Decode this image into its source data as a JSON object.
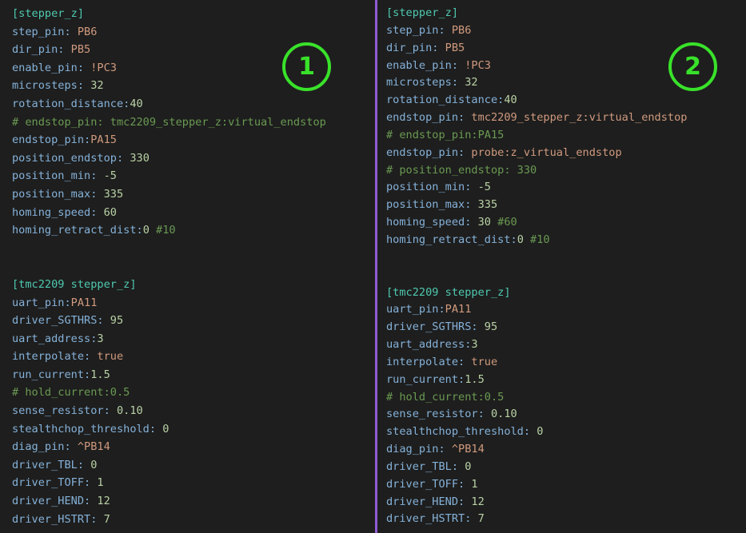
{
  "panels": [
    {
      "badge": "1",
      "lines": [
        {
          "type": "section",
          "text": "[stepper_z]"
        },
        {
          "type": "kv",
          "key": "step_pin: ",
          "value": "PB6",
          "vtype": "str"
        },
        {
          "type": "kv",
          "key": "dir_pin: ",
          "value": "PB5",
          "vtype": "str"
        },
        {
          "type": "kv",
          "key": "enable_pin: ",
          "value": "!PC3",
          "vtype": "str"
        },
        {
          "type": "kv",
          "key": "microsteps: ",
          "value": "32",
          "vtype": "num"
        },
        {
          "type": "kv",
          "key": "rotation_distance:",
          "value": "40",
          "vtype": "num"
        },
        {
          "type": "comment",
          "text": "# endstop_pin: tmc2209_stepper_z:virtual_endstop"
        },
        {
          "type": "kv",
          "key": "endstop_pin:",
          "value": "PA15",
          "vtype": "str"
        },
        {
          "type": "kv",
          "key": "position_endstop: ",
          "value": "330",
          "vtype": "num"
        },
        {
          "type": "kv",
          "key": "position_min: ",
          "value": "-5",
          "vtype": "num"
        },
        {
          "type": "kv",
          "key": "position_max: ",
          "value": "335",
          "vtype": "num"
        },
        {
          "type": "kv",
          "key": "homing_speed: ",
          "value": "60",
          "vtype": "num"
        },
        {
          "type": "kv",
          "key": "homing_retract_dist:",
          "value": "0",
          "vtype": "num",
          "comment": " #10"
        },
        {
          "type": "blank"
        },
        {
          "type": "blank"
        },
        {
          "type": "section",
          "text": "[tmc2209 stepper_z]"
        },
        {
          "type": "kv",
          "key": "uart_pin:",
          "value": "PA11",
          "vtype": "str"
        },
        {
          "type": "kv",
          "key": "driver_SGTHRS: ",
          "value": "95",
          "vtype": "num"
        },
        {
          "type": "kv",
          "key": "uart_address:",
          "value": "3",
          "vtype": "num"
        },
        {
          "type": "kv",
          "key": "interpolate: ",
          "value": "true",
          "vtype": "str"
        },
        {
          "type": "kv",
          "key": "run_current:",
          "value": "1.5",
          "vtype": "num"
        },
        {
          "type": "comment",
          "text": "# hold_current:0.5"
        },
        {
          "type": "kv",
          "key": "sense_resistor: ",
          "value": "0.10",
          "vtype": "num"
        },
        {
          "type": "kv",
          "key": "stealthchop_threshold: ",
          "value": "0",
          "vtype": "num"
        },
        {
          "type": "kv",
          "key": "diag_pin: ",
          "value": "^PB14",
          "vtype": "str"
        },
        {
          "type": "kv",
          "key": "driver_TBL: ",
          "value": "0",
          "vtype": "num"
        },
        {
          "type": "kv",
          "key": "driver_TOFF: ",
          "value": "1",
          "vtype": "num"
        },
        {
          "type": "kv",
          "key": "driver_HEND: ",
          "value": "12",
          "vtype": "num"
        },
        {
          "type": "kv",
          "key": "driver_HSTRT: ",
          "value": "7",
          "vtype": "num"
        }
      ]
    },
    {
      "badge": "2",
      "lines": [
        {
          "type": "section",
          "text": "[stepper_z]"
        },
        {
          "type": "kv",
          "key": "step_pin: ",
          "value": "PB6",
          "vtype": "str"
        },
        {
          "type": "kv",
          "key": "dir_pin: ",
          "value": "PB5",
          "vtype": "str"
        },
        {
          "type": "kv",
          "key": "enable_pin: ",
          "value": "!PC3",
          "vtype": "str"
        },
        {
          "type": "kv",
          "key": "microsteps: ",
          "value": "32",
          "vtype": "num"
        },
        {
          "type": "kv",
          "key": "rotation_distance:",
          "value": "40",
          "vtype": "num"
        },
        {
          "type": "kv",
          "key": "endstop_pin: ",
          "value": "tmc2209_stepper_z:virtual_endstop",
          "vtype": "str"
        },
        {
          "type": "comment",
          "text": "# endstop_pin:PA15"
        },
        {
          "type": "kv",
          "key": "endstop_pin: ",
          "value": "probe:z_virtual_endstop",
          "vtype": "str"
        },
        {
          "type": "comment",
          "text": "# position_endstop: 330"
        },
        {
          "type": "kv",
          "key": "position_min: ",
          "value": "-5",
          "vtype": "num"
        },
        {
          "type": "kv",
          "key": "position_max: ",
          "value": "335",
          "vtype": "num"
        },
        {
          "type": "kv",
          "key": "homing_speed: ",
          "value": "30",
          "vtype": "num",
          "comment": " #60"
        },
        {
          "type": "kv",
          "key": "homing_retract_dist:",
          "value": "0",
          "vtype": "num",
          "comment": " #10"
        },
        {
          "type": "blank"
        },
        {
          "type": "blank"
        },
        {
          "type": "section",
          "text": "[tmc2209 stepper_z]"
        },
        {
          "type": "kv",
          "key": "uart_pin:",
          "value": "PA11",
          "vtype": "str"
        },
        {
          "type": "kv",
          "key": "driver_SGTHRS: ",
          "value": "95",
          "vtype": "num"
        },
        {
          "type": "kv",
          "key": "uart_address:",
          "value": "3",
          "vtype": "num"
        },
        {
          "type": "kv",
          "key": "interpolate: ",
          "value": "true",
          "vtype": "str"
        },
        {
          "type": "kv",
          "key": "run_current:",
          "value": "1.5",
          "vtype": "num"
        },
        {
          "type": "comment",
          "text": "# hold_current:0.5"
        },
        {
          "type": "kv",
          "key": "sense_resistor: ",
          "value": "0.10",
          "vtype": "num"
        },
        {
          "type": "kv",
          "key": "stealthchop_threshold: ",
          "value": "0",
          "vtype": "num"
        },
        {
          "type": "kv",
          "key": "diag_pin: ",
          "value": "^PB14",
          "vtype": "str"
        },
        {
          "type": "kv",
          "key": "driver_TBL: ",
          "value": "0",
          "vtype": "num"
        },
        {
          "type": "kv",
          "key": "driver_TOFF: ",
          "value": "1",
          "vtype": "num"
        },
        {
          "type": "kv",
          "key": "driver_HEND: ",
          "value": "12",
          "vtype": "num"
        },
        {
          "type": "kv",
          "key": "driver_HSTRT: ",
          "value": "7",
          "vtype": "num"
        }
      ]
    }
  ],
  "colors": {
    "background": "#1e1e1e",
    "divider": "#8f5bd6",
    "badge": "#39e22a",
    "key": "#85b2d9",
    "section": "#4ec9b0",
    "string_value": "#d09a7e",
    "number_value": "#b9d2a5",
    "comment": "#6a9a52"
  }
}
